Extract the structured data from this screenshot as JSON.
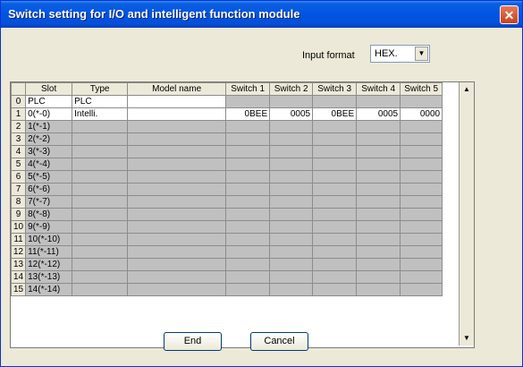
{
  "window": {
    "title": "Switch setting for I/O and intelligent function module"
  },
  "input_format": {
    "label": "Input format",
    "value": "HEX."
  },
  "table": {
    "columns": [
      "",
      "Slot",
      "Type",
      "Model name",
      "Switch 1",
      "Switch 2",
      "Switch 3",
      "Switch 4",
      "Switch 5"
    ],
    "rows": [
      [
        "0",
        "PLC",
        "PLC",
        "",
        "",
        "",
        "",
        "",
        ""
      ],
      [
        "1",
        "0(*-0)",
        "Intelli.",
        "",
        "0BEE",
        "0005",
        "0BEE",
        "0005",
        "0000"
      ],
      [
        "2",
        "1(*-1)",
        "",
        "",
        "",
        "",
        "",
        "",
        ""
      ],
      [
        "3",
        "2(*-2)",
        "",
        "",
        "",
        "",
        "",
        "",
        ""
      ],
      [
        "4",
        "3(*-3)",
        "",
        "",
        "",
        "",
        "",
        "",
        ""
      ],
      [
        "5",
        "4(*-4)",
        "",
        "",
        "",
        "",
        "",
        "",
        ""
      ],
      [
        "6",
        "5(*-5)",
        "",
        "",
        "",
        "",
        "",
        "",
        ""
      ],
      [
        "7",
        "6(*-6)",
        "",
        "",
        "",
        "",
        "",
        "",
        ""
      ],
      [
        "8",
        "7(*-7)",
        "",
        "",
        "",
        "",
        "",
        "",
        ""
      ],
      [
        "9",
        "8(*-8)",
        "",
        "",
        "",
        "",
        "",
        "",
        ""
      ],
      [
        "10",
        "9(*-9)",
        "",
        "",
        "",
        "",
        "",
        "",
        ""
      ],
      [
        "11",
        "10(*-10)",
        "",
        "",
        "",
        "",
        "",
        "",
        ""
      ],
      [
        "12",
        "11(*-11)",
        "",
        "",
        "",
        "",
        "",
        "",
        ""
      ],
      [
        "13",
        "12(*-12)",
        "",
        "",
        "",
        "",
        "",
        "",
        ""
      ],
      [
        "14",
        "13(*-13)",
        "",
        "",
        "",
        "",
        "",
        "",
        ""
      ],
      [
        "15",
        "14(*-14)",
        "",
        "",
        "",
        "",
        "",
        "",
        ""
      ]
    ]
  },
  "buttons": {
    "end": "End",
    "cancel": "Cancel"
  },
  "icons": {
    "close": "close-icon",
    "dropdown": "chevron-down-icon",
    "scroll_up": "scroll-up-icon",
    "scroll_down": "scroll-down-icon"
  },
  "colors": {
    "titlebar": "#0054e3",
    "window_bg": "#ece9d8",
    "disabled_cell": "#c0c0c0"
  }
}
